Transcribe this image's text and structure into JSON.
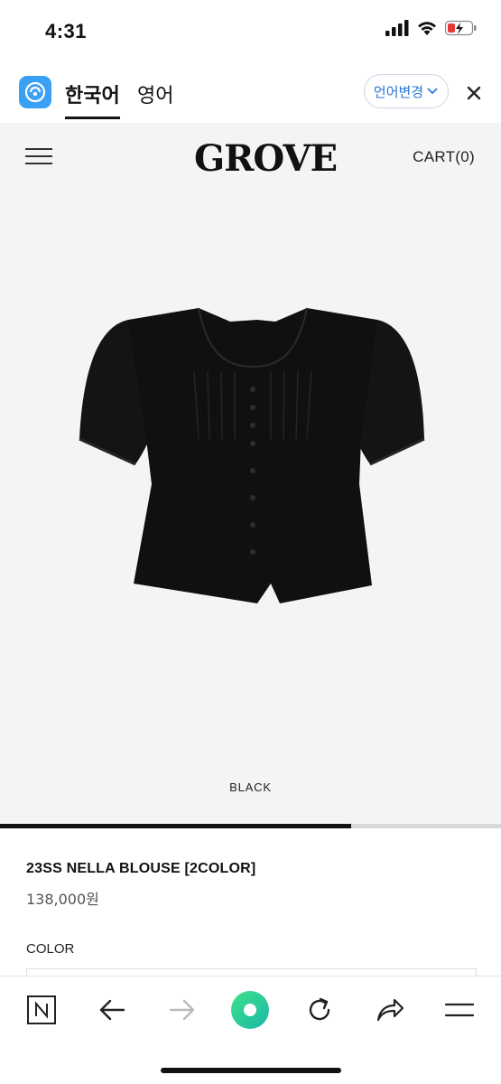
{
  "status_bar": {
    "time": "4:31"
  },
  "translate_bar": {
    "tabs": [
      {
        "label": "한국어"
      },
      {
        "label": "영어"
      }
    ],
    "change_language_label": "언어변경"
  },
  "site": {
    "brand": "GROVE",
    "cart_label": "CART(0)",
    "image_caption": "BLACK",
    "gallery_progress": 0.7,
    "product": {
      "name": "23SS NELLA BLOUSE [2COLOR]",
      "price": "138,000원"
    },
    "color_label": "COLOR"
  },
  "icons": {
    "app_logo": "papago-icon",
    "menu": "hamburger-menu-icon",
    "toolbar": [
      "naver-n-icon",
      "back-arrow-icon",
      "forward-arrow-icon",
      "green-dot-icon",
      "refresh-icon",
      "share-icon",
      "menu-icon"
    ]
  }
}
